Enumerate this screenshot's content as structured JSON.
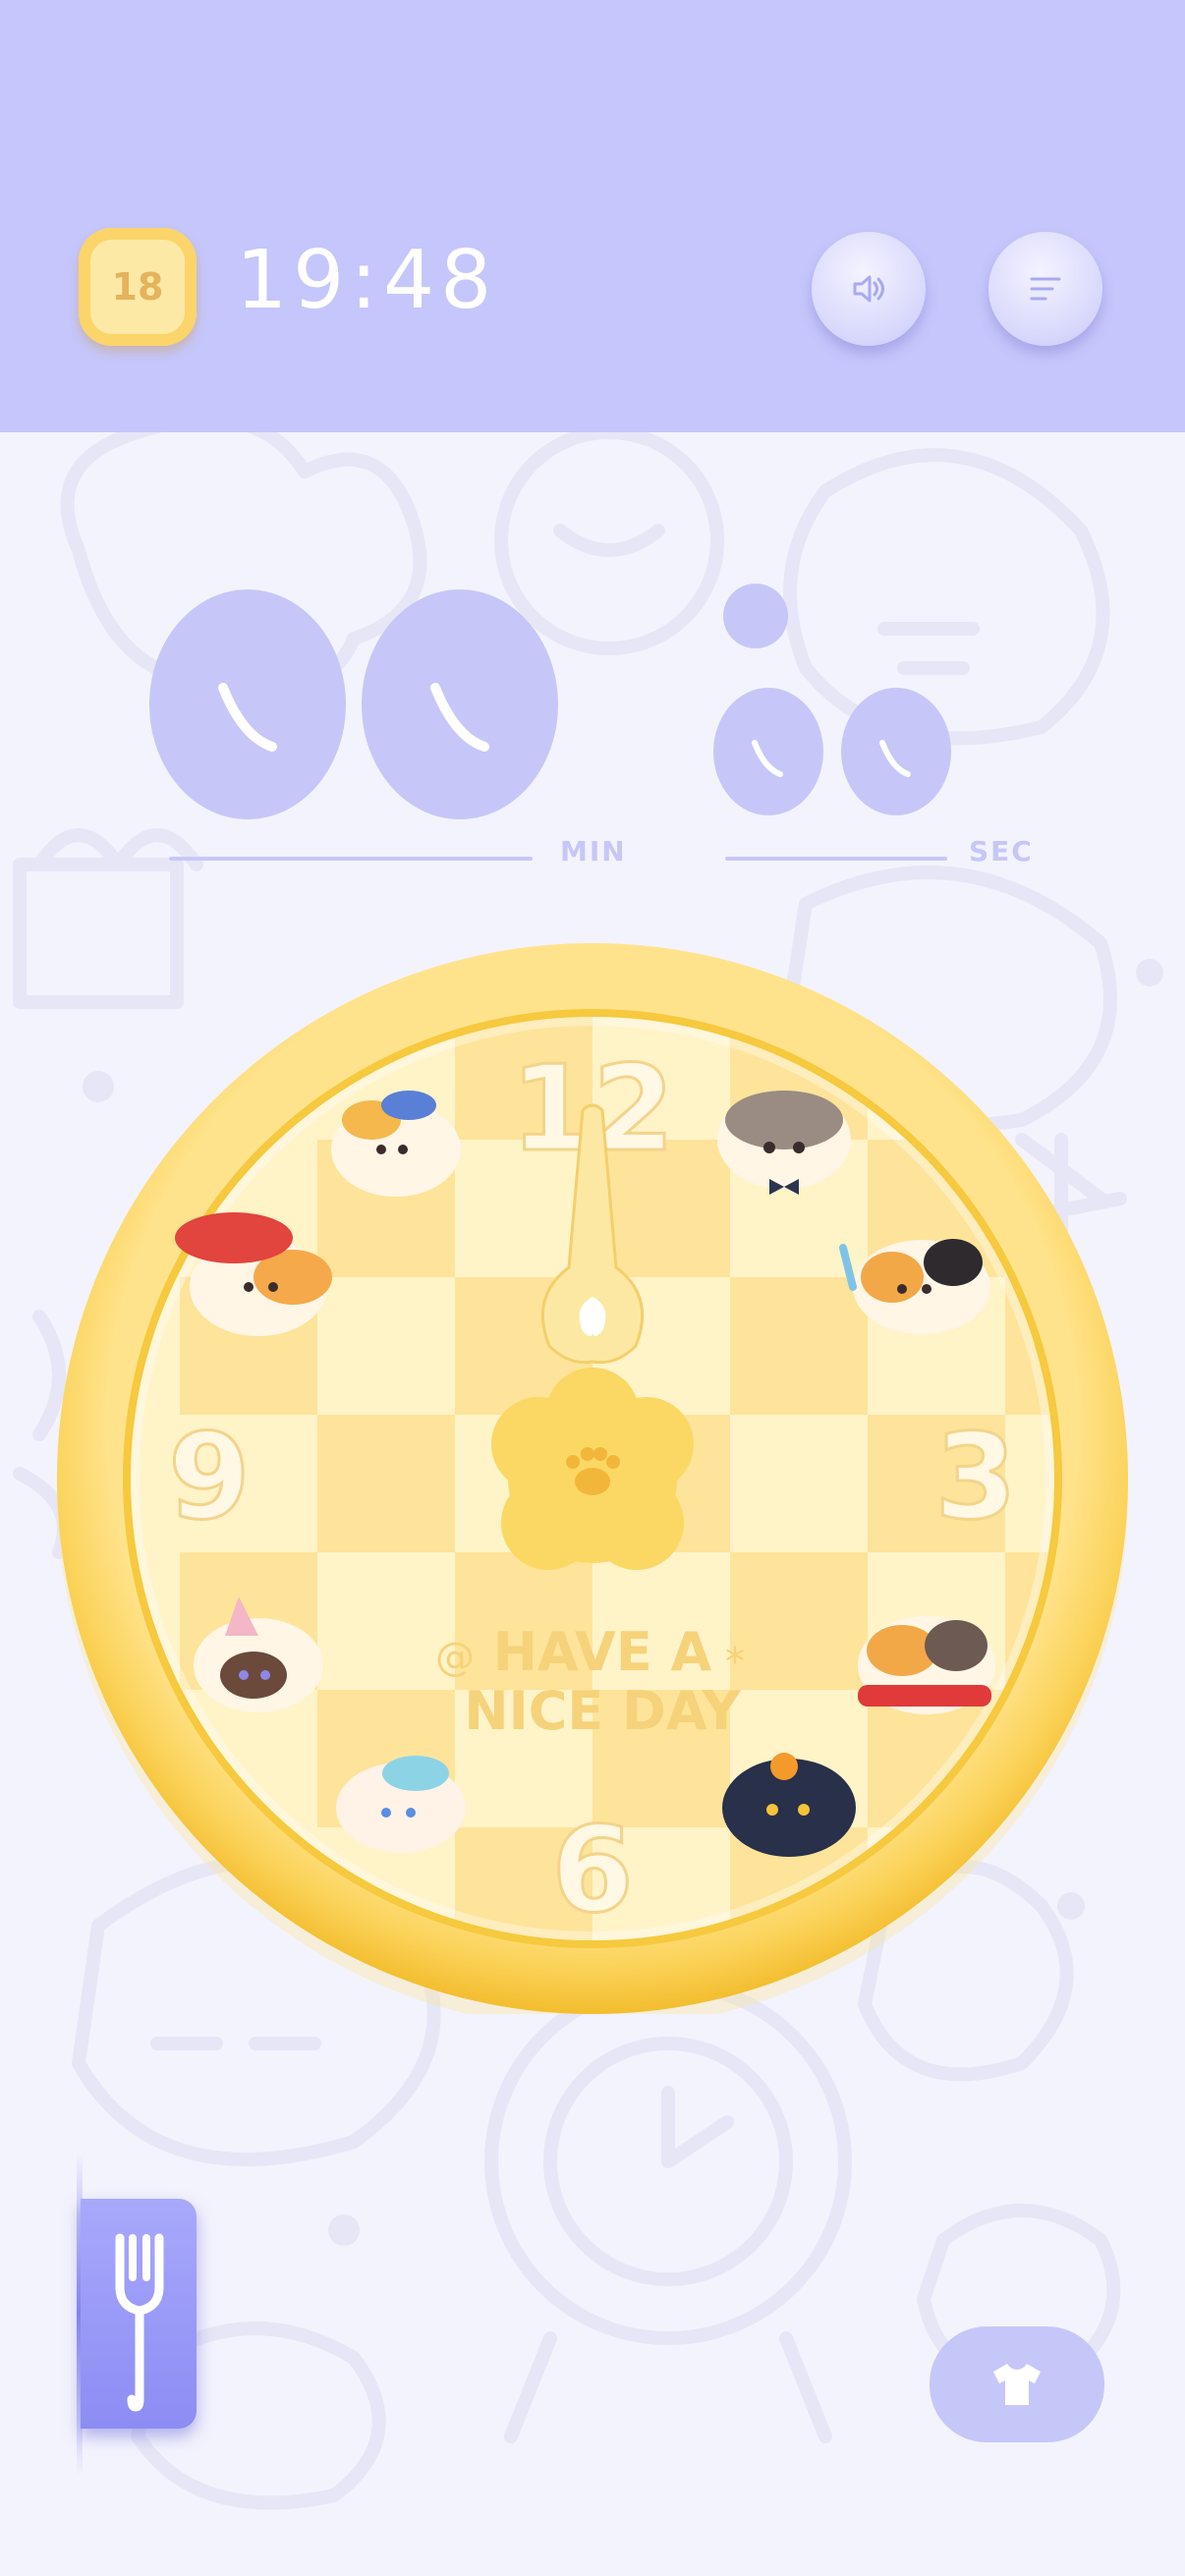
{
  "header": {
    "day_badge": "18",
    "time": "19:48",
    "sound_button": "sound-icon",
    "menu_button": "menu-icon"
  },
  "timer": {
    "min_label": "MIN",
    "sec_label": "SEC"
  },
  "clock": {
    "numbers": [
      "12",
      "3",
      "6",
      "9"
    ],
    "message_line1": "HAVE A",
    "message_line2": "NICE DAY"
  },
  "bottom": {
    "left_button": "fork-icon",
    "right_button": "shirt-icon"
  },
  "colors": {
    "header_bg": "#c5c6fb",
    "page_bg": "#f3f3fd",
    "accent": "#c6c7f8",
    "clock_rim": "#fbd35a"
  }
}
